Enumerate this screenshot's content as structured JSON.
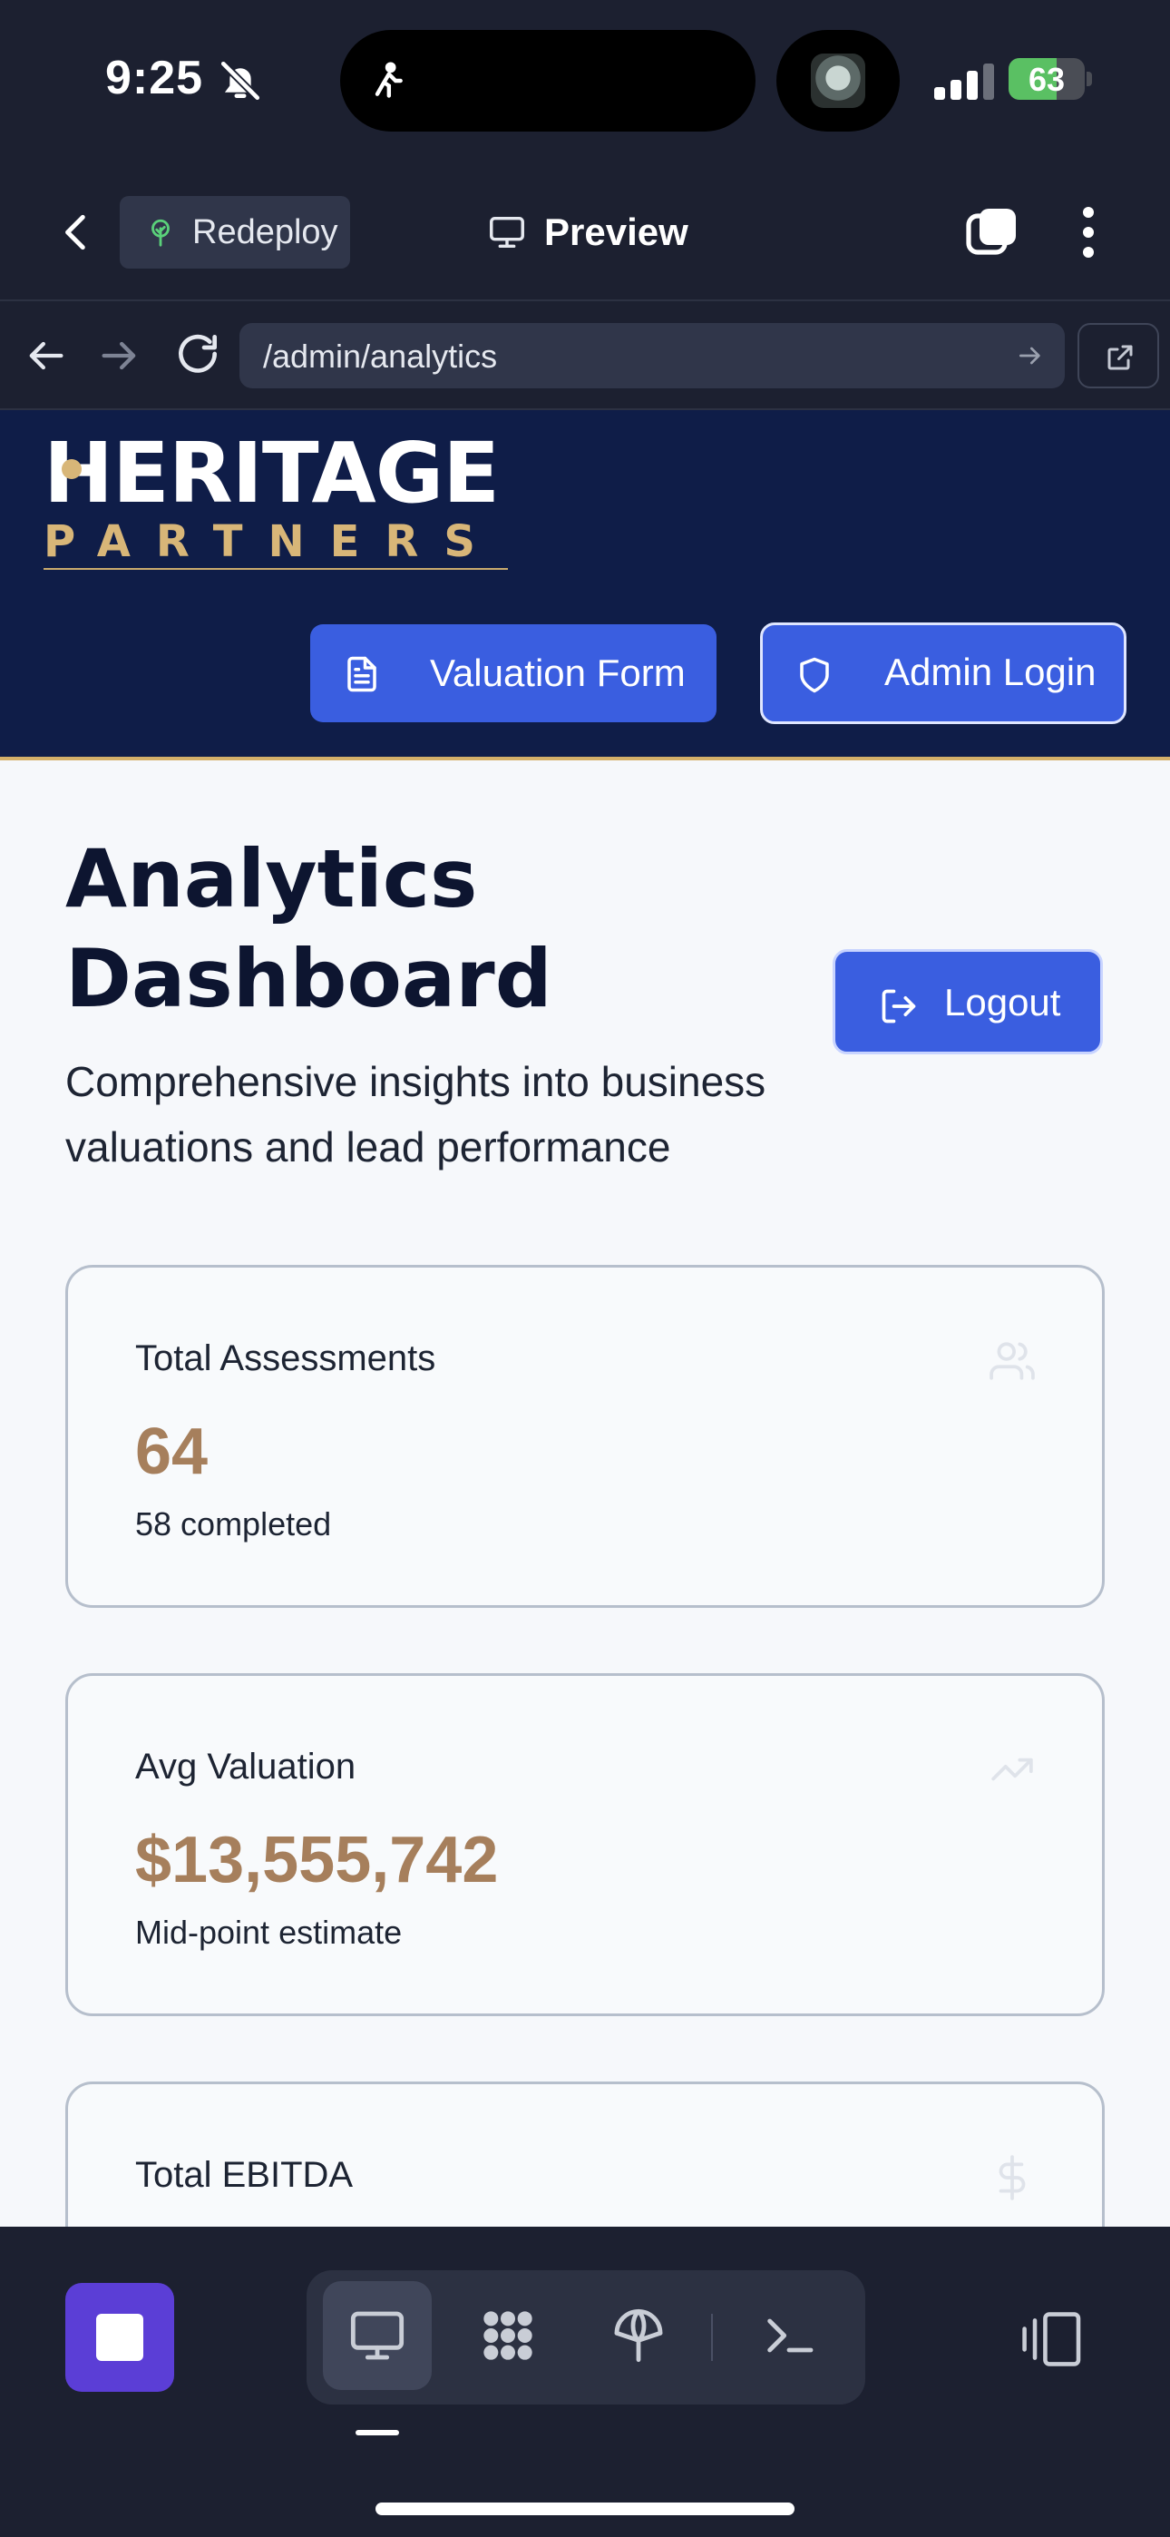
{
  "status_bar": {
    "time": "9:25",
    "battery_percent": "63",
    "battery_level": 0.63,
    "icons": [
      "bell-slash-icon",
      "walking-icon",
      "avatar-image",
      "signal-icon",
      "battery-icon"
    ]
  },
  "app_header": {
    "redeploy_label": "Redeploy",
    "preview_label": "Preview",
    "icons": [
      "chevron-left-icon",
      "tree-icon",
      "monitor-icon",
      "tabs-icon",
      "more-vertical-icon"
    ]
  },
  "url_bar": {
    "url": "/admin/analytics",
    "icons": [
      "arrow-left-icon",
      "arrow-right-icon",
      "reload-icon",
      "go-arrow-icon",
      "open-external-icon"
    ]
  },
  "site_header": {
    "logo_top": "HERITAGE",
    "logo_bottom": "PARTNERS",
    "valuation_button": "Valuation Form",
    "admin_button": "Admin Login",
    "icons": [
      "document-icon",
      "shield-icon"
    ]
  },
  "page": {
    "title": "Analytics Dashboard",
    "subtitle": "Comprehensive insights into business valuations and lead performance",
    "logout_button": "Logout"
  },
  "cards": [
    {
      "label": "Total Assessments",
      "value": "64",
      "sub": "58 completed",
      "icon": "users-icon"
    },
    {
      "label": "Avg Valuation",
      "value": "$13,555,742",
      "sub": "Mid-point estimate",
      "icon": "trending-up-icon"
    },
    {
      "label": "Total EBITDA",
      "value": "",
      "sub": "",
      "icon": "dollar-icon"
    }
  ],
  "toolbar": {
    "icons": [
      "stop-icon",
      "monitor-icon",
      "apps-icon",
      "network-icon",
      "terminal-icon",
      "layout-icon"
    ],
    "colors": {
      "stop_button": "#5b3ed6",
      "active_tool": "#40465a"
    }
  },
  "colors": {
    "site_header_bg": "#0f1d48",
    "accent_blue": "#3a5ee0",
    "gold": "#d8b678",
    "value_brown": "#a67f5c"
  }
}
